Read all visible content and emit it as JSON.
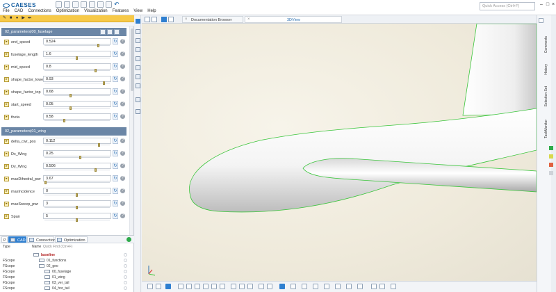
{
  "app": {
    "logo": "CAESES",
    "quick_access_placeholder": "Quick Access (Ctrl+F)"
  },
  "menu": [
    "File",
    "CAD",
    "Connections",
    "Optimization",
    "Visualization",
    "Features",
    "View",
    "Help"
  ],
  "groups": [
    {
      "title": "02_parameters|00_fuselage",
      "params": [
        {
          "name": "end_speed",
          "value": "0.524",
          "slider": 0.84
        },
        {
          "name": "fuselage_length",
          "value": "1.6",
          "slider": 0.5
        },
        {
          "name": "mid_speed",
          "value": "0.8",
          "slider": 0.8
        },
        {
          "name": "shape_factor_lower",
          "value": "0.93",
          "slider": 0.93
        },
        {
          "name": "shape_factor_top",
          "value": "0.68",
          "slider": 0.4
        },
        {
          "name": "start_speed",
          "value": "0.05",
          "slider": 0.4
        },
        {
          "name": "theta",
          "value": "0.58",
          "slider": 0.3
        }
      ]
    },
    {
      "title": "02_parameters|01_wing",
      "params": [
        {
          "name": "delta_cwr_pos",
          "value": "0.112",
          "slider": 0.85
        },
        {
          "name": "Dx_Wing",
          "value": "0.25",
          "slider": 0.55
        },
        {
          "name": "Dy_Wing",
          "value": "0.506",
          "slider": 0.8
        },
        {
          "name": "maxDihedral_pwr",
          "value": "3.67",
          "slider": 0.0
        },
        {
          "name": "maxIncidence",
          "value": "0",
          "slider": 0.5
        },
        {
          "name": "maxSweep_pwr",
          "value": "3",
          "slider": 0.5
        },
        {
          "name": "Span",
          "value": "5",
          "slider": 0.5
        }
      ]
    }
  ],
  "tree": {
    "tabs": [
      "CAD",
      "Connections",
      "Optimization"
    ],
    "header": {
      "type": "Type",
      "name": "Name",
      "filter": "Quick Find (Ctrl+F)"
    },
    "rows": [
      {
        "type": "",
        "name": "baseline",
        "indent": 1,
        "bold": true
      },
      {
        "type": "FScope",
        "name": "01_functions",
        "indent": 2,
        "bold": false
      },
      {
        "type": "FScope",
        "name": "02_geo",
        "indent": 2,
        "bold": false
      },
      {
        "type": "FScope",
        "name": "00_fuselage",
        "indent": 3,
        "bold": false
      },
      {
        "type": "FScope",
        "name": "01_wing",
        "indent": 3,
        "bold": false
      },
      {
        "type": "FScope",
        "name": "03_ver_tail",
        "indent": 3,
        "bold": false
      },
      {
        "type": "FScope",
        "name": "04_hor_tail",
        "indent": 3,
        "bold": false
      }
    ]
  },
  "view_tabs": [
    {
      "label": "Documentation Browser",
      "active": false
    },
    {
      "label": "3DView",
      "active": true
    }
  ],
  "right_panel": [
    "Comments",
    "History",
    "Selection Set",
    "TaskMonitor"
  ],
  "colors": {
    "accent": "#2f7fd0",
    "highlight": "#f7c948",
    "group_header": "#6b86a6",
    "outline": "#39c53a"
  }
}
